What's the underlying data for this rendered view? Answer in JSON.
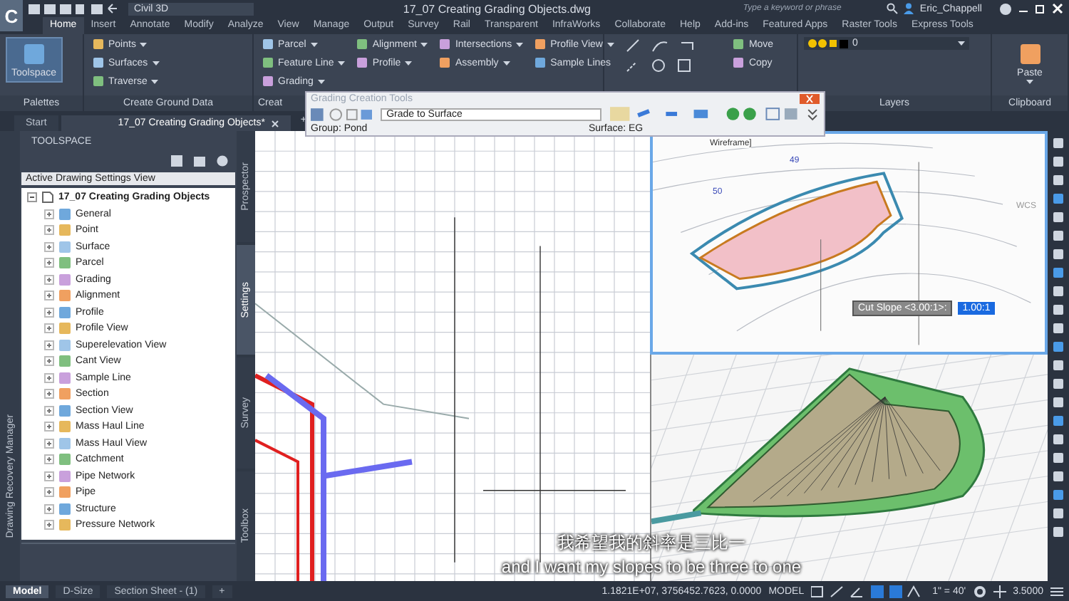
{
  "title_bar": {
    "logo": "C",
    "workspace": "Civil 3D",
    "title": "17_07 Creating Grading Objects.dwg",
    "search": {
      "placeholder": "Type a keyword or phrase"
    },
    "user": "Eric_Chappell"
  },
  "ribbon_tabs": [
    {
      "label": "Home",
      "selected": true
    },
    {
      "label": "Insert",
      "selected": false
    },
    {
      "label": "Annotate",
      "selected": false
    },
    {
      "label": "Modify",
      "selected": false
    },
    {
      "label": "Analyze",
      "selected": false
    },
    {
      "label": "View",
      "selected": false
    },
    {
      "label": "Manage",
      "selected": false
    },
    {
      "label": "Output",
      "selected": false
    },
    {
      "label": "Survey",
      "selected": false
    },
    {
      "label": "Rail",
      "selected": false
    },
    {
      "label": "Transparent",
      "selected": false
    },
    {
      "label": "InfraWorks",
      "selected": false
    },
    {
      "label": "Collaborate",
      "selected": false
    },
    {
      "label": "Help",
      "selected": false
    },
    {
      "label": "Add-ins",
      "selected": false
    },
    {
      "label": "Featured Apps",
      "selected": false
    },
    {
      "label": "Raster Tools",
      "selected": false
    },
    {
      "label": "Express Tools",
      "selected": false
    }
  ],
  "ribbon": {
    "panels": [
      {
        "title": "Palettes",
        "columns": [
          [
            {
              "label": "Toolspace",
              "kind": "large",
              "menu": false
            }
          ]
        ]
      },
      {
        "title": "Create Ground Data",
        "columns": [
          [
            {
              "label": "Points",
              "kind": "small",
              "menu": true
            },
            {
              "label": "Surfaces",
              "kind": "small",
              "menu": true
            },
            {
              "label": "Traverse",
              "kind": "small",
              "menu": true
            }
          ]
        ]
      },
      {
        "title": "Creat",
        "columns": [
          [
            {
              "label": "Parcel",
              "kind": "small",
              "menu": true
            },
            {
              "label": "Feature Line",
              "kind": "small",
              "menu": true
            },
            {
              "label": "Grading",
              "kind": "small",
              "menu": true
            }
          ],
          [
            {
              "label": "Alignment",
              "kind": "small",
              "menu": true
            },
            {
              "label": "Profile",
              "kind": "small",
              "menu": true
            }
          ],
          [
            {
              "label": "Intersections",
              "kind": "small",
              "menu": true
            },
            {
              "label": "Assembly",
              "kind": "small",
              "menu": true
            }
          ],
          [
            {
              "label": "Profile View",
              "kind": "small",
              "menu": true
            },
            {
              "label": "Sample Lines",
              "kind": "small",
              "menu": false
            }
          ]
        ]
      },
      {
        "columns": [
          [
            {
              "label": "Move",
              "kind": "small",
              "menu": false
            },
            {
              "label": "Copy",
              "kind": "small",
              "menu": false
            }
          ]
        ]
      },
      {
        "title": "Layers",
        "columns": [
          [
            {
              "label": "0",
              "kind": "layer",
              "menu": true
            }
          ]
        ]
      },
      {
        "title": "Clipboard",
        "columns": [
          [
            {
              "label": "Paste",
              "kind": "large",
              "menu": true
            }
          ]
        ]
      }
    ]
  },
  "doc_tabs": [
    {
      "label": "Start",
      "selected": false,
      "closable": false
    },
    {
      "label": "17_07 Creating Grading Objects*",
      "selected": true,
      "closable": true
    }
  ],
  "new_tab": "+",
  "grading_toolbar": {
    "title": "Grading Creation Tools",
    "criteria": "Grade to Surface",
    "group": "Group: Pond",
    "surface": "Surface: EG"
  },
  "recovery_manager": "Drawing Recovery Manager",
  "toolspace": {
    "title": "TOOLSPACE",
    "view": "Active Drawing Settings View",
    "tree": {
      "label": "17_07 Creating Grading Objects",
      "expanded": true,
      "children": [
        {
          "label": "General",
          "expanded": false
        },
        {
          "label": "Point",
          "expanded": false
        },
        {
          "label": "Surface",
          "expanded": false
        },
        {
          "label": "Parcel",
          "expanded": false
        },
        {
          "label": "Grading",
          "expanded": false
        },
        {
          "label": "Alignment",
          "expanded": false
        },
        {
          "label": "Profile",
          "expanded": false
        },
        {
          "label": "Profile View",
          "expanded": false
        },
        {
          "label": "Superelevation View",
          "expanded": false
        },
        {
          "label": "Cant View",
          "expanded": false
        },
        {
          "label": "Sample Line",
          "expanded": false
        },
        {
          "label": "Section",
          "expanded": false
        },
        {
          "label": "Section View",
          "expanded": false
        },
        {
          "label": "Mass Haul Line",
          "expanded": false
        },
        {
          "label": "Mass Haul View",
          "expanded": false
        },
        {
          "label": "Catchment",
          "expanded": false
        },
        {
          "label": "Pipe Network",
          "expanded": false
        },
        {
          "label": "Pipe",
          "expanded": false
        },
        {
          "label": "Structure",
          "expanded": false
        },
        {
          "label": "Pressure Network",
          "expanded": false
        }
      ]
    },
    "side_tabs": [
      {
        "label": "Prospector",
        "selected": false
      },
      {
        "label": "Settings",
        "selected": true
      },
      {
        "label": "Survey",
        "selected": false
      },
      {
        "label": "Toolbox",
        "selected": false
      }
    ]
  },
  "plan_viewport": {
    "view_label": "Wireframe]",
    "contours": [
      "49",
      "50"
    ],
    "ucs": "WCS",
    "prompt": "Cut Slope <3.00:1>:",
    "input": "1.00:1"
  },
  "captions": [
    "我希望我的斜率是三比一",
    "and I want my slopes to be three to one"
  ],
  "status_bar": {
    "layouts": [
      {
        "label": "Model",
        "selected": true
      },
      {
        "label": "D-Size",
        "selected": false
      },
      {
        "label": "Section Sheet - (1)",
        "selected": false
      }
    ],
    "new_layout": "+",
    "coordinates": "1.1821E+07, 3756452.7623, 0.0000",
    "space": "MODEL",
    "scale": "1\" = 40'",
    "precision": "3.5000"
  }
}
